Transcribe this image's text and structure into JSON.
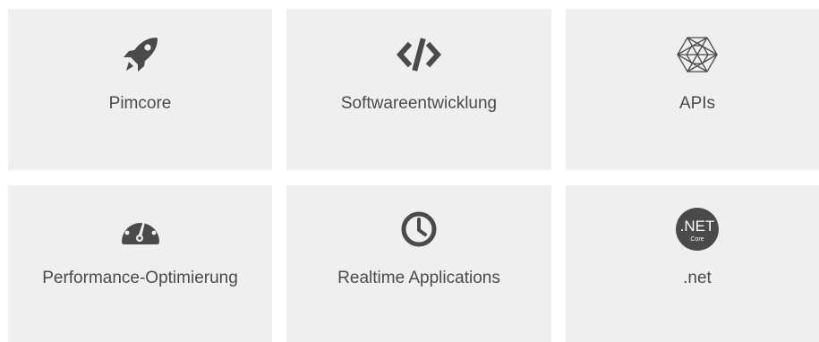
{
  "colors": {
    "tile_background": "#efefef",
    "icon": "#4a4a4a",
    "text": "#4a4a4a"
  },
  "tiles": [
    {
      "label": "Pimcore",
      "icon": "rocket-icon"
    },
    {
      "label": "Softwareentwicklung",
      "icon": "code-icon"
    },
    {
      "label": "APIs",
      "icon": "hexagon-mesh-icon"
    },
    {
      "label": "Performance-Optimierung",
      "icon": "speedometer-icon"
    },
    {
      "label": "Realtime Applications",
      "icon": "clock-icon"
    },
    {
      "label": ".net",
      "icon": "dotnet-core-icon",
      "badge_main": ".NET",
      "badge_sub": "Core"
    }
  ]
}
